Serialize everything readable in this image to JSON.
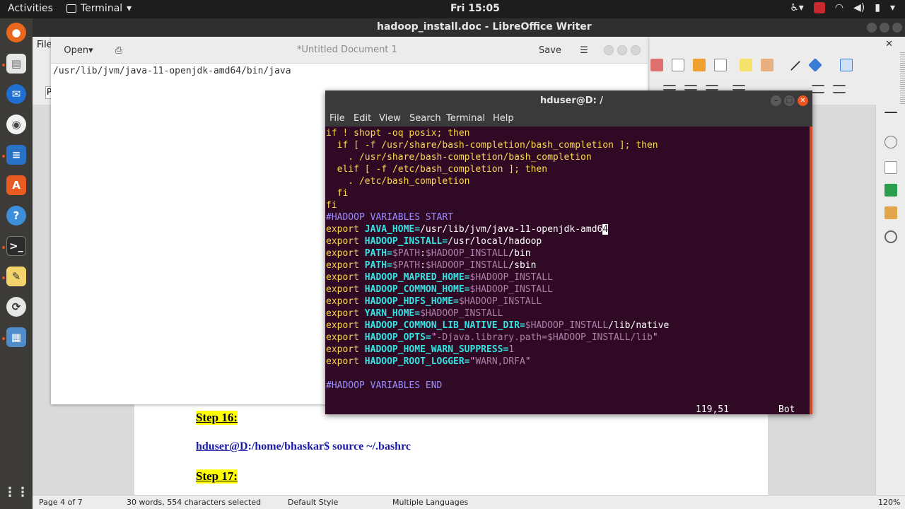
{
  "topbar": {
    "activities": "Activities",
    "app_menu": "Terminal",
    "clock": "Fri 15:05"
  },
  "libreoffice": {
    "window_title": "hadoop_install.doc - LibreOffice Writer",
    "menu_file_partial": "File",
    "para_style_partial": "P",
    "steps": [
      {
        "label": "Step 16:"
      },
      {
        "label": "Step 17:"
      }
    ],
    "command_user": "hduser@D",
    "command_rest": ":/home/bhaskar$ source ~/.bashrc",
    "statusbar": {
      "page": "Page 4 of 7",
      "words": "30 words, 554 characters selected",
      "style": "Default Style",
      "language": "Multiple Languages",
      "zoom": "120%"
    }
  },
  "gedit": {
    "open_label": "Open",
    "save_label": "Save",
    "title": "*Untitled Document 1",
    "text": "/usr/lib/jvm/java-11-openjdk-amd64/bin/java"
  },
  "terminal": {
    "title": "hduser@D: /",
    "menu": [
      "File",
      "Edit",
      "View",
      "Search",
      "Terminal",
      "Help"
    ],
    "lines": {
      "l1_a": "if",
      "l1_b": " ! shopt -oq posix; ",
      "l1_c": "then",
      "l2_a": "  if",
      "l2_b": " [ -f /usr/share/bash-completion/bash_completion ]; ",
      "l2_c": "then",
      "l3": "    . /usr/share/bash-completion/bash_completion",
      "l4_a": "  elif",
      "l4_b": " [ -f /etc/bash_completion ]; ",
      "l4_c": "then",
      "l5": "    . /etc/bash_completion",
      "l6": "  fi",
      "l7": "fi",
      "comment_start": "#HADOOP VARIABLES START",
      "comment_end": "#HADOOP VARIABLES END",
      "export": "export",
      "v1_name": "JAVA_HOME=",
      "v1_val": "/usr/lib/jvm/java-11-openjdk-amd6",
      "v1_cursor": "4",
      "v2_name": "HADOOP_INSTALL=",
      "v2_val": "/usr/local/hadoop",
      "v3_name": "PATH=",
      "v3_a": "$PATH",
      "v3_b": ":",
      "v3_c": "$HADOOP_INSTALL",
      "v3_d": "/bin",
      "v4_d": "/sbin",
      "v5_name": "HADOOP_MAPRED_HOME=",
      "v6_name": "HADOOP_COMMON_HOME=",
      "v7_name": "HADOOP_HDFS_HOME=",
      "v8_name": "YARN_HOME=",
      "v9_name": "HADOOP_COMMON_LIB_NATIVE_DIR=",
      "v9_tail": "/lib/native",
      "v10_name": "HADOOP_OPTS=",
      "v10_q": "\"",
      "v10_a": "-Djava.library.path=",
      "v10_b": "$HADOOP_INSTALL",
      "v10_c": "/lib",
      "v11_name": "HADOOP_HOME_WARN_SUPPRESS=",
      "v11_val": "1",
      "v12_name": "HADOOP_ROOT_LOGGER=",
      "v12_val": "WARN,DRFA",
      "var_install": "$HADOOP_INSTALL"
    },
    "status_pos": "119,51",
    "status_bot": "Bot"
  },
  "colors": {
    "terminal_bg": "#300a24",
    "accent": "#e95420",
    "highlight": "#ffff00"
  }
}
